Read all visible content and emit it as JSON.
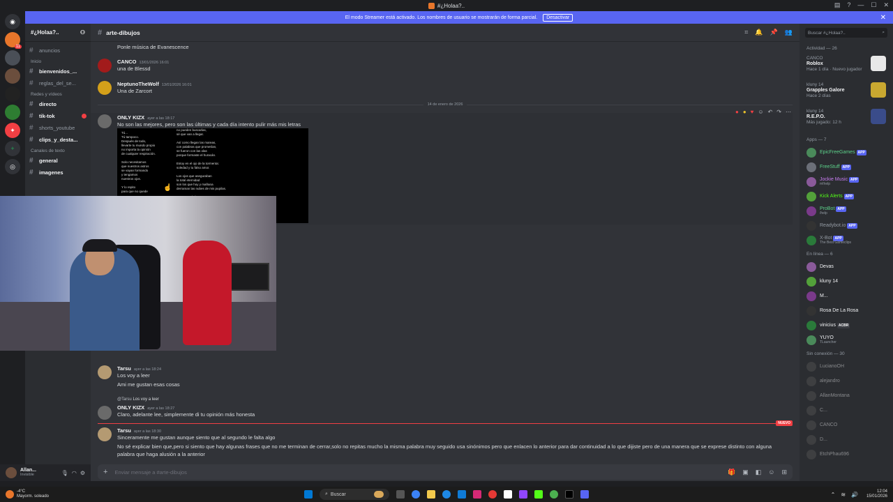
{
  "window": {
    "title": "#¿Holaa?.."
  },
  "banner": {
    "text": "El modo Streamer está activado. Los nombres de usuario se mostrarán de forma parcial.",
    "button": "Desactivar"
  },
  "server": {
    "name": "#¿Holaa?..",
    "chevron": "chevron-down"
  },
  "sidebar": {
    "channels_top": [
      {
        "label": "anuncios"
      }
    ],
    "sec_inicio": "Inicio",
    "channels_inicio": [
      {
        "label": "bienvenidos_..."
      },
      {
        "label": "reglas_del_se..."
      }
    ],
    "sec_redes": "Redes y vídeos",
    "channels_redes": [
      {
        "label": "directo"
      },
      {
        "label": "tik-tok"
      },
      {
        "label": "shorts_youtube"
      },
      {
        "label": "clips_y_desta..."
      }
    ],
    "sec_texto": "Canales de texto",
    "channels_texto": [
      {
        "label": "general"
      },
      {
        "label": "imagenes"
      }
    ]
  },
  "user": {
    "name": "Allan...",
    "status": "Invisible"
  },
  "channel": {
    "name": "arte-dibujos"
  },
  "messages": [
    {
      "text": "Ponle música de Evanescence"
    },
    {
      "author": "CANCO",
      "ts": "13/01/2026 16:01",
      "text": "una de Blessd"
    },
    {
      "author": "NeptunoTheWolf",
      "ts": "13/01/2026 16:01",
      "text": "Una de Zarcort"
    },
    {
      "author": "ONLY KIZX",
      "ts": "ayer a las 18:17",
      "text": "No son las mejores, pero son las últimas y cada día intento pulir más mis letras"
    },
    {
      "author": "Tarsu",
      "ts": "ayer a las 18:24",
      "text": "Los voy a leer",
      "text2": "Ami me gustan esas cosas"
    },
    {
      "reply_author": "@Tarsu",
      "reply_text": "Los voy a leer",
      "author": "ONLY KIZX",
      "ts": "ayer a las 18:27",
      "text": "Claro, adelante lee, simplemente di tu opinión más honesta"
    },
    {
      "author": "Tarsu",
      "ts": "ayer a las 18:30",
      "text": "Sinceramente me gustan aunque siento que al segundo le falta algo",
      "text2": "No sé explicar bien que,pero si siento que hay algunas frases que no me terminan de cerrar,solo no repitas mucho la misma palabra muy seguido usa sinónimos pero que enlacen lo anterior para dar continuidad a lo que dijiste pero de una manera que se exprese distinto con alguna",
      "text3": "palabra que haga alusión a la anterior"
    }
  ],
  "date_separator": "14 de enero de 2026",
  "new_label": "NUEVO",
  "poem_left": "Tú...\nTú tampoco.\nDespués de todo,\nllevarte tu mundo propio\nno importa la opinión\nde cualquier respiración.\n\nSolo necesitamos\nque nuestros astros\nse vayan formando\ny tengamos\nnuestros ojos.\n\nY lo repito\npara que no quede",
  "poem_right": "no pueden buscarlas,\nsé que van a llegar.\n\nAsí como llegan las mareas,\ncon palabras que prometían,\nse fueron con las olas\nporque formaste el huracán.\n\nEstoy en el ojo de la tormenta:\nsoledad y tu falso amor.\n\nLos ojos que aseguraban\nla total eternidad\nson los que hoy y mañana\nderraman las nubes de mis pupilas.\n\nNo eres solo la tormenta.",
  "composer": {
    "placeholder": "Enviar mensaje a #arte-dibujos"
  },
  "right": {
    "search": "Buscar #¿Holaa?..",
    "activity_header": "Actividad — 26",
    "activities": [
      {
        "user": "CANCO",
        "game": "Roblox",
        "meta": "Hace 1 día",
        "tag": "Nuevo jugador"
      },
      {
        "user": "kluny 14",
        "game": "Grapples Galore",
        "meta": "Hace 2 días"
      },
      {
        "user": "kluny 14",
        "game": "R.E.P.O.",
        "meta": "Más jugado: 12 h"
      }
    ],
    "apps_header": "Apps — 7",
    "apps": [
      {
        "name": "EpicFreeGames",
        "color": "#5dd38b"
      },
      {
        "name": "FreeStuff",
        "color": "#5dd38b"
      },
      {
        "name": "Jockie Music",
        "sub": "m!help",
        "color": "#c97ef2"
      },
      {
        "name": "Kick Alerts",
        "color": "#53fc18"
      },
      {
        "name": "ProBot",
        "sub": "/help",
        "color": "#5dd38b"
      },
      {
        "name": "Readybot.io",
        "color": "#949ba4"
      },
      {
        "name": "X-Bot",
        "sub": "The Best Gameclips",
        "color": "#949ba4"
      }
    ],
    "app_tag": "APP",
    "online_header": "En línea — 6",
    "online": [
      {
        "name": "Devas"
      },
      {
        "name": "kluny 14"
      },
      {
        "name": "M..."
      },
      {
        "name": "Rosa De La Rosa"
      },
      {
        "name": "vinicius",
        "tag": "ACBR"
      },
      {
        "name": "YUYO",
        "sub": "TLauncher"
      }
    ],
    "offline_header": "Sin conexión — 30",
    "offline": [
      {
        "name": "LucianoOH"
      },
      {
        "name": "alejandro"
      },
      {
        "name": "AllanMontana"
      },
      {
        "name": "C..."
      },
      {
        "name": "CANCO"
      },
      {
        "name": "D..."
      },
      {
        "name": "EtchPhau696"
      }
    ]
  },
  "taskbar": {
    "temp": "-4°C",
    "weather": "Mayorm. soleado",
    "search": "Buscar",
    "time": "12:04",
    "date": "15/01/2026"
  }
}
